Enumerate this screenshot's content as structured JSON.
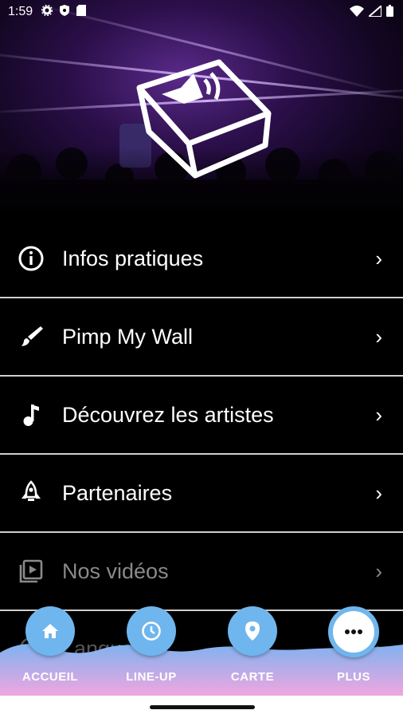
{
  "status": {
    "time": "1:59"
  },
  "menu": {
    "items": [
      {
        "label": "Infos pratiques",
        "icon": "info-icon"
      },
      {
        "label": "Pimp My Wall",
        "icon": "brush-icon"
      },
      {
        "label": "Découvrez les artistes",
        "icon": "music-note-icon"
      },
      {
        "label": "Partenaires",
        "icon": "rocket-icon"
      },
      {
        "label": "Nos vidéos",
        "icon": "video-library-icon"
      },
      {
        "label": "Langue",
        "icon": "globe-icon"
      }
    ]
  },
  "tabs": [
    {
      "label": "ACCUEIL",
      "icon": "home-icon"
    },
    {
      "label": "LINE-UP",
      "icon": "clock-icon"
    },
    {
      "label": "CARTE",
      "icon": "map-pin-icon"
    },
    {
      "label": "PLUS",
      "icon": "more-icon"
    }
  ],
  "colors": {
    "tab_accent": "#6fb6ee",
    "wave_top": "#7fb2f0",
    "wave_bottom": "#f0a6e0"
  }
}
